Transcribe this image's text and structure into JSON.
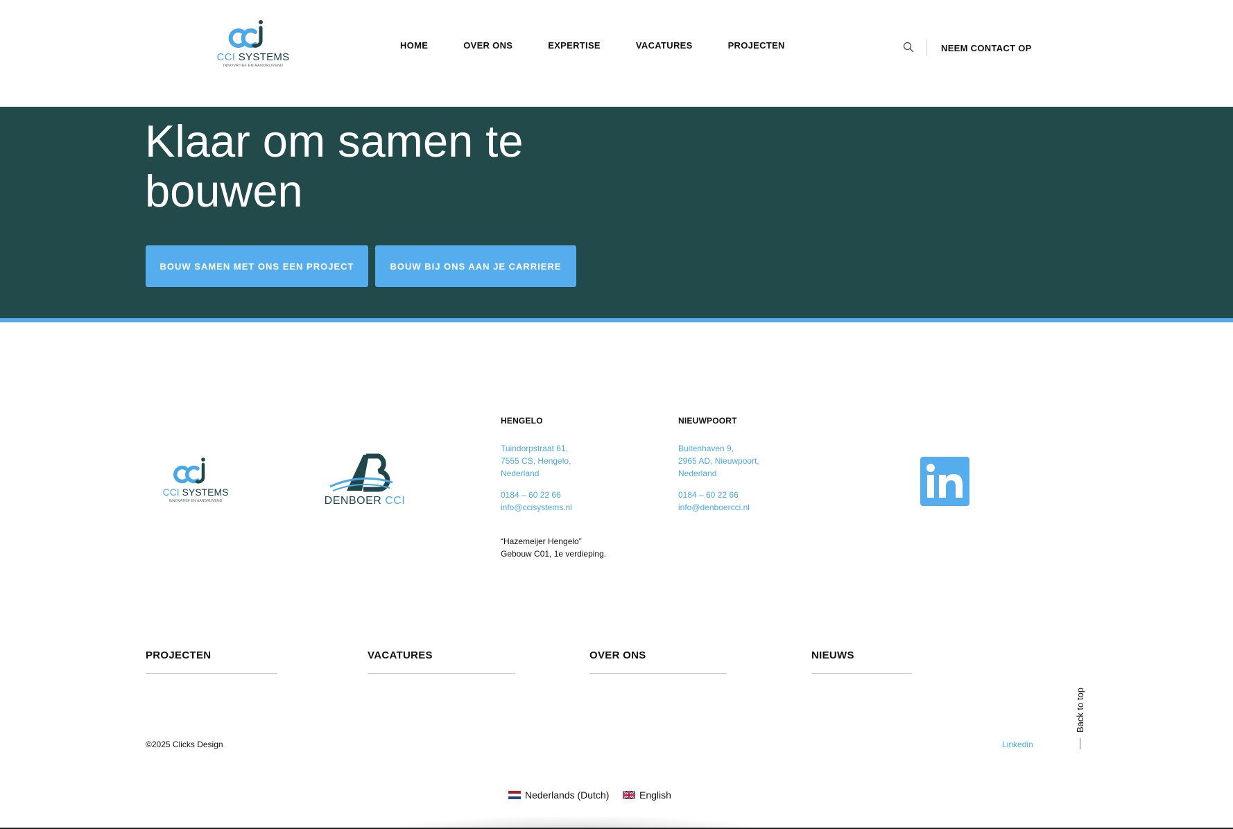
{
  "header": {
    "logo": {
      "wordmark_a": "CCI",
      "wordmark_b": "SYSTEMS",
      "tagline": "INNOVATIEF EN AANDRIJVEND"
    },
    "nav": [
      {
        "label": "HOME"
      },
      {
        "label": "OVER ONS"
      },
      {
        "label": "EXPERTISE"
      },
      {
        "label": "VACATURES"
      },
      {
        "label": "PROJECTEN"
      }
    ],
    "contact_label": "NEEM CONTACT OP"
  },
  "hero": {
    "title": "Klaar om samen te bouwen",
    "buttons": {
      "project": "BOUW SAMEN MET ONS EEN PROJECT",
      "career": "BOUW BIJ ONS AAN JE CARRIERE"
    }
  },
  "footer": {
    "logo_cci": {
      "wordmark_a": "CCI",
      "wordmark_b": "SYSTEMS",
      "tagline": "INNOVATIEF EN AANDRIJVEND"
    },
    "logo_db": {
      "wordmark_a": "DENBOER",
      "wordmark_b": "CCI"
    },
    "hengelo": {
      "title": "HENGELO",
      "address": [
        "Tuindorpstraat 61,",
        "7555 CS, Hengelo,",
        "Nederland"
      ],
      "phone": "0184 – 60 22 66",
      "email": "info@ccisystems.nl",
      "note": [
        "“Hazemeijer Hengelo”",
        "Gebouw C01, 1e verdieping."
      ]
    },
    "nieuwpoort": {
      "title": "NIEUWPOORT",
      "address": [
        "Buitenhaven 9,",
        "2965 AD, Nieuwpoort,",
        "Nederland"
      ],
      "phone": "0184 – 60 22 66",
      "email": "info@denboercci.nl"
    },
    "nav": [
      {
        "label": "PROJECTEN"
      },
      {
        "label": "VACATURES"
      },
      {
        "label": "OVER ONS"
      },
      {
        "label": "NIEUWS"
      }
    ],
    "copyright": "©2025 Clicks Design",
    "linkedin_link": "Linkedin",
    "back_to_top": "Back to top",
    "languages": [
      {
        "label": "Nederlands (Dutch)"
      },
      {
        "label": "English"
      }
    ]
  },
  "colors": {
    "hero_bg": "#234a4b",
    "accent_blue": "#56adee",
    "link_blue": "#4aa8e8"
  }
}
